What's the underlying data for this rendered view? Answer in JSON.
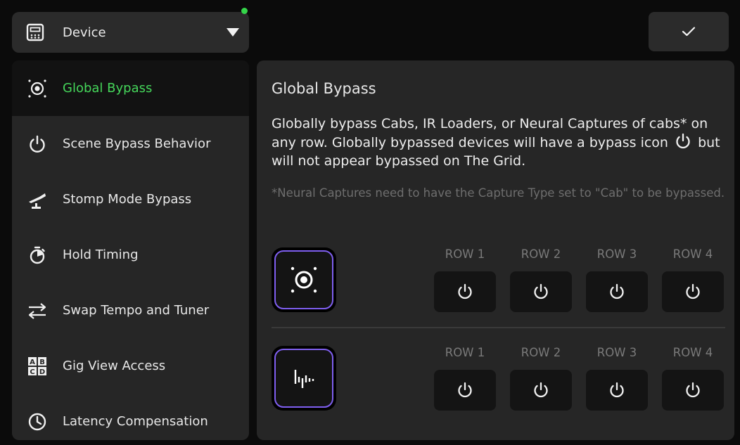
{
  "device_select": {
    "label": "Device",
    "status_color": "#35d64a",
    "icon": "device-icon",
    "caret_icon": "caret-down-icon"
  },
  "confirm_button": {
    "icon": "check-icon"
  },
  "sidebar": {
    "active_color": "#45d65a",
    "items": [
      {
        "label": "Global Bypass",
        "icon": "target-icon",
        "active": true
      },
      {
        "label": "Scene Bypass Behavior",
        "icon": "power-icon",
        "active": false
      },
      {
        "label": "Stomp Mode Bypass",
        "icon": "footswitch-icon",
        "active": false
      },
      {
        "label": "Hold Timing",
        "icon": "timer-icon",
        "active": false
      },
      {
        "label": "Swap Tempo and Tuner",
        "icon": "swap-arrows-icon",
        "active": false
      },
      {
        "label": "Gig View Access",
        "icon": "abcd-grid-icon",
        "active": false
      },
      {
        "label": "Latency Compensation",
        "icon": "clock-icon",
        "active": false
      }
    ]
  },
  "panel": {
    "title": "Global Bypass",
    "description_part1": "Globally bypass Cabs, IR Loaders, or Neural Captures of cabs* on any row. Globally bypassed devices will have a bypass icon",
    "description_part2": "but will not appear bypassed on The Grid.",
    "note": "*Neural Captures need to have the Capture Type set to \"Cab\" to be bypassed.",
    "accent_color": "#7f5ff0",
    "devices": [
      {
        "icon": "speaker-target-icon",
        "rows": [
          "ROW 1",
          "ROW 2",
          "ROW 3",
          "ROW 4"
        ]
      },
      {
        "icon": "waveform-icon",
        "rows": [
          "ROW 1",
          "ROW 2",
          "ROW 3",
          "ROW 4"
        ]
      }
    ]
  }
}
